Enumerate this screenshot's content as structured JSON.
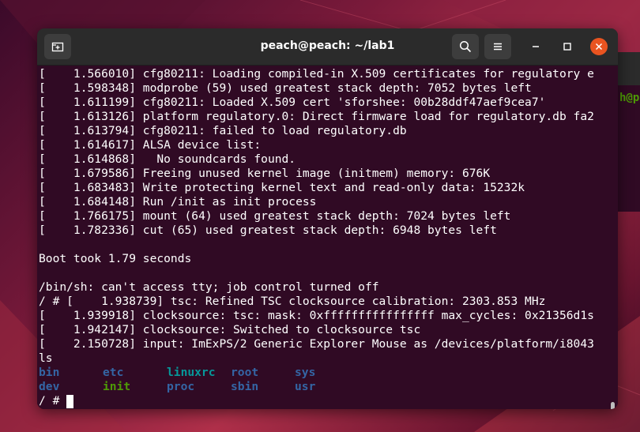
{
  "window": {
    "title": "peach@peach: ~/lab1"
  },
  "background_terminal": {
    "visible_text": "h@p"
  },
  "terminal": {
    "lines": [
      "[    1.566010] cfg80211: Loading compiled-in X.509 certificates for regulatory e",
      "[    1.598348] modprobe (59) used greatest stack depth: 7052 bytes left",
      "[    1.611199] cfg80211: Loaded X.509 cert 'sforshee: 00b28ddf47aef9cea7'",
      "[    1.613126] platform regulatory.0: Direct firmware load for regulatory.db fa2",
      "[    1.613794] cfg80211: failed to load regulatory.db",
      "[    1.614617] ALSA device list:",
      "[    1.614868]   No soundcards found.",
      "[    1.679586] Freeing unused kernel image (initmem) memory: 676K",
      "[    1.683483] Write protecting kernel text and read-only data: 15232k",
      "[    1.684148] Run /init as init process",
      "[    1.766175] mount (64) used greatest stack depth: 7024 bytes left",
      "[    1.782336] cut (65) used greatest stack depth: 6948 bytes left",
      "",
      "Boot took 1.79 seconds",
      "",
      "/bin/sh: can't access tty; job control turned off",
      "/ # [    1.938739] tsc: Refined TSC clocksource calibration: 2303.853 MHz",
      "[    1.939918] clocksource: tsc: mask: 0xffffffffffffffff max_cycles: 0x21356d1s",
      "[    1.942147] clocksource: Switched to clocksource tsc",
      "[    2.150728] input: ImExPS/2 Generic Explorer Mouse as /devices/platform/i8043",
      "ls"
    ],
    "ls_rows": [
      [
        {
          "name": "bin",
          "type": "dir"
        },
        {
          "name": "etc",
          "type": "dir"
        },
        {
          "name": "linuxrc",
          "type": "link"
        },
        {
          "name": "root",
          "type": "dir"
        },
        {
          "name": "sys",
          "type": "dir"
        }
      ],
      [
        {
          "name": "dev",
          "type": "dir"
        },
        {
          "name": "init",
          "type": "exec"
        },
        {
          "name": "proc",
          "type": "dir"
        },
        {
          "name": "sbin",
          "type": "dir"
        },
        {
          "name": "usr",
          "type": "dir"
        }
      ]
    ],
    "prompt": "/ # "
  },
  "icons": {
    "new_tab": "new-tab-icon",
    "search": "search-icon",
    "menu": "hamburger-menu-icon",
    "minimize": "minimize-icon",
    "maximize": "maximize-icon",
    "close": "close-icon"
  },
  "colors": {
    "terminal_bg": "#300a24",
    "titlebar_bg": "#2b2b2b",
    "close_button": "#e95420",
    "dir_color": "#3465a4",
    "exec_color": "#4e9a06",
    "link_color": "#06989a"
  }
}
